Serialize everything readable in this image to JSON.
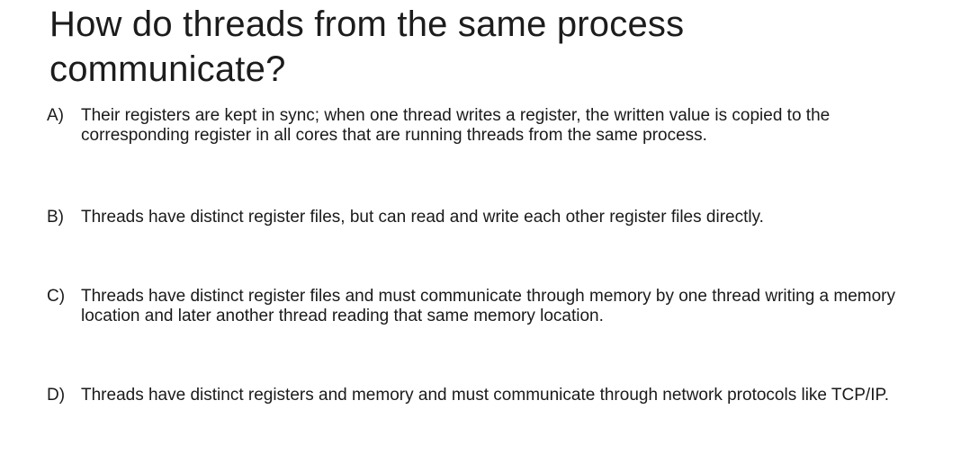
{
  "slide": {
    "title": "How do threads from the same process communicate?",
    "options": [
      {
        "letter": "A)",
        "text": "Their registers are kept in sync; when one thread writes a register, the written value is copied to the corresponding register in all cores that are running threads from the same process."
      },
      {
        "letter": "B)",
        "text": "Threads have distinct register files, but can read and write each other register files directly."
      },
      {
        "letter": "C)",
        "text": "Threads have distinct register files and must communicate through memory by one thread writing a memory location and later another thread reading that same memory location."
      },
      {
        "letter": "D)",
        "text": "Threads have distinct registers and memory and must communicate through network protocols like TCP/IP."
      }
    ]
  }
}
